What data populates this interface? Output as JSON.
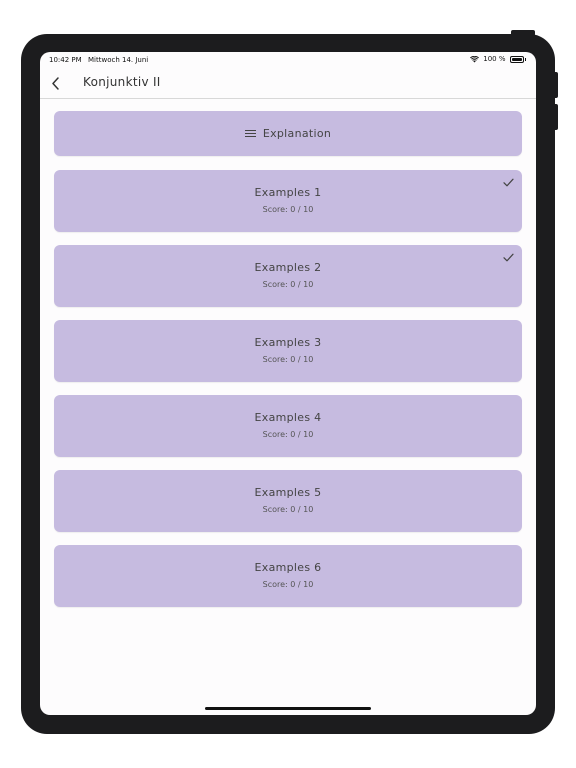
{
  "status_bar": {
    "time": "10:42 PM",
    "date": "Mittwoch 14. Juni",
    "battery": "100 %",
    "battery_level": 1.0,
    "wifi_icon": "wifi-icon",
    "battery_icon": "battery-icon"
  },
  "app_bar": {
    "title": "Konjunktiv II",
    "back_icon": "chevron-left-icon"
  },
  "explanation": {
    "label": "Explanation",
    "icon": "menu-icon"
  },
  "examples": [
    {
      "title": "Examples 1",
      "score": "Score: 0 / 10",
      "checked": true
    },
    {
      "title": "Examples 2",
      "score": "Score: 0 / 10",
      "checked": true
    },
    {
      "title": "Examples 3",
      "score": "Score: 0 / 10",
      "checked": false
    },
    {
      "title": "Examples 4",
      "score": "Score: 0 / 10",
      "checked": false
    },
    {
      "title": "Examples 5",
      "score": "Score: 0 / 10",
      "checked": false
    },
    {
      "title": "Examples 6",
      "score": "Score: 0 / 10",
      "checked": false
    }
  ],
  "colors": {
    "card": "#c6bbe0",
    "background": "#fdfcfd",
    "device_frame": "#1c1c1e",
    "text": "#444444"
  }
}
